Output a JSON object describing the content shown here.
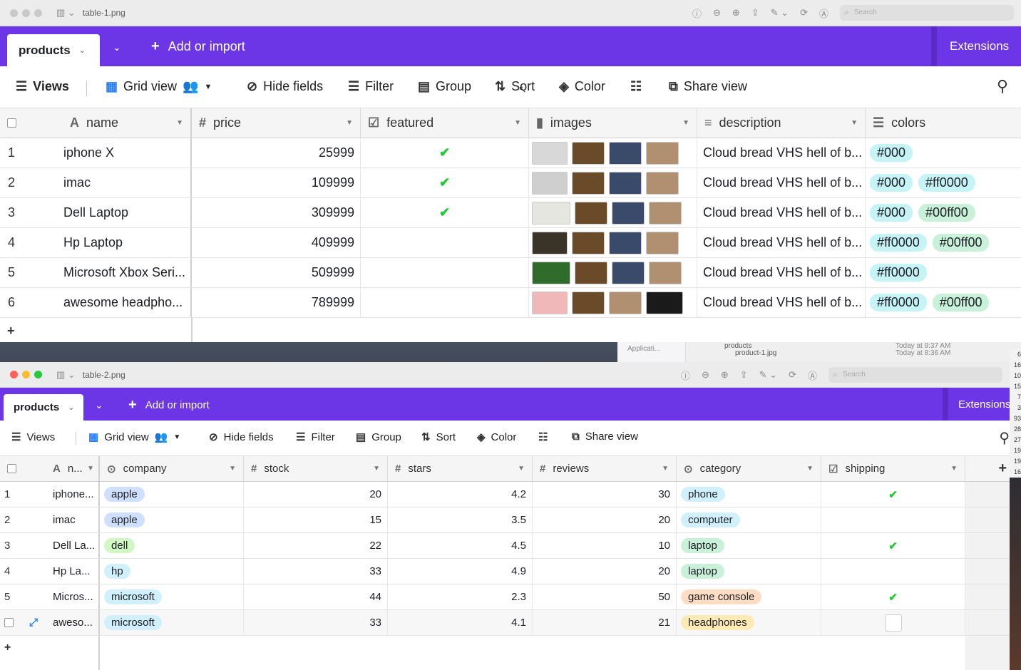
{
  "win1": {
    "filename": "table-1.png",
    "search_placeholder": "Search",
    "tab": "products",
    "add_import": "Add or import",
    "extensions": "Extensions",
    "toolbar": {
      "views": "Views",
      "grid": "Grid view",
      "hide": "Hide fields",
      "filter": "Filter",
      "group": "Group",
      "sort": "Sort",
      "color": "Color",
      "share": "Share view"
    },
    "headers": {
      "name": "name",
      "price": "price",
      "featured": "featured",
      "images": "images",
      "description": "description",
      "colors": "colors"
    },
    "rows": [
      {
        "n": "1",
        "name": "iphone X",
        "price": "25999",
        "featured": true,
        "desc": "Cloud bread VHS hell of b...",
        "colors": [
          "#000"
        ]
      },
      {
        "n": "2",
        "name": "imac",
        "price": "109999",
        "featured": true,
        "desc": "Cloud bread VHS hell of b...",
        "colors": [
          "#000",
          "#ff0000"
        ]
      },
      {
        "n": "3",
        "name": "Dell Laptop",
        "price": "309999",
        "featured": true,
        "desc": "Cloud bread VHS hell of b...",
        "colors": [
          "#000",
          "#00ff00"
        ]
      },
      {
        "n": "4",
        "name": "Hp Laptop",
        "price": "409999",
        "featured": false,
        "desc": "Cloud bread VHS hell of b...",
        "colors": [
          "#ff0000",
          "#00ff00"
        ]
      },
      {
        "n": "5",
        "name": "Microsoft Xbox Seri...",
        "price": "509999",
        "featured": false,
        "desc": "Cloud bread VHS hell of b...",
        "colors": [
          "#ff0000"
        ]
      },
      {
        "n": "6",
        "name": "awesome headpho...",
        "price": "789999",
        "featured": false,
        "desc": "Cloud bread VHS hell of b...",
        "colors": [
          "#ff0000",
          "#00ff00"
        ]
      }
    ]
  },
  "finder": {
    "app": "Applicati...",
    "folder": "products",
    "file": "product-1.jpg",
    "t1": "Today at 9:37 AM",
    "t2": "Today at 8:36 AM"
  },
  "right_numbers": [
    "6",
    "16",
    "10",
    "15",
    "7",
    "3",
    "93",
    "28",
    "27",
    "19",
    "19",
    "16"
  ],
  "win2": {
    "filename": "table-2.png",
    "search_placeholder": "Search",
    "tab": "products",
    "add_import": "Add or import",
    "extensions": "Extensions",
    "toolbar": {
      "views": "Views",
      "grid": "Grid view",
      "hide": "Hide fields",
      "filter": "Filter",
      "group": "Group",
      "sort": "Sort",
      "color": "Color",
      "share": "Share view"
    },
    "headers": {
      "name": "n...",
      "company": "company",
      "stock": "stock",
      "stars": "stars",
      "reviews": "reviews",
      "category": "category",
      "shipping": "shipping"
    },
    "rows": [
      {
        "n": "1",
        "name": "iphone...",
        "company": "apple",
        "stock": "20",
        "stars": "4.2",
        "reviews": "30",
        "category": "phone",
        "shipping": true
      },
      {
        "n": "2",
        "name": "imac",
        "company": "apple",
        "stock": "15",
        "stars": "3.5",
        "reviews": "20",
        "category": "computer",
        "shipping": false
      },
      {
        "n": "3",
        "name": "Dell La...",
        "company": "dell",
        "stock": "22",
        "stars": "4.5",
        "reviews": "10",
        "category": "laptop",
        "shipping": true
      },
      {
        "n": "4",
        "name": "Hp La...",
        "company": "hp",
        "stock": "33",
        "stars": "4.9",
        "reviews": "20",
        "category": "laptop",
        "shipping": false
      },
      {
        "n": "5",
        "name": "Micros...",
        "company": "microsoft",
        "stock": "44",
        "stars": "2.3",
        "reviews": "50",
        "category": "game console",
        "shipping": true
      },
      {
        "n": "6",
        "name": "aweso...",
        "company": "microsoft",
        "stock": "33",
        "stars": "4.1",
        "reviews": "21",
        "category": "headphones",
        "shipping": false
      }
    ]
  }
}
